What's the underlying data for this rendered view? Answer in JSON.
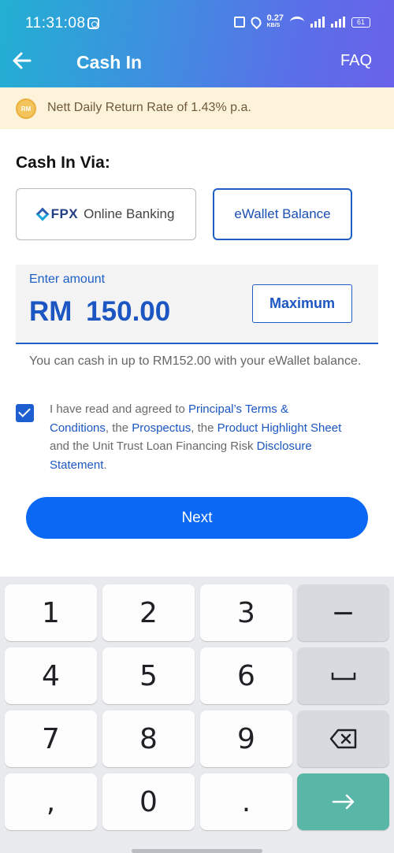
{
  "status_bar": {
    "time": "11:31:08",
    "network_speed": "0.27",
    "network_unit": "KB/S",
    "battery": "61"
  },
  "header": {
    "title": "Cash In",
    "faq_label": "FAQ"
  },
  "banner": {
    "icon_text": "RM",
    "text": "Nett Daily Return Rate of 1.43% p.a."
  },
  "cash_in": {
    "title": "Cash In Via:",
    "options": [
      {
        "logo_text": "FPX",
        "label": "Online Banking",
        "selected": false
      },
      {
        "label": "eWallet Balance",
        "selected": true
      }
    ]
  },
  "amount": {
    "label": "Enter amount",
    "currency": "RM",
    "value": "150.00",
    "maximum_label": "Maximum"
  },
  "limit_text": "You can cash in up to RM152.00 with your eWallet balance.",
  "terms": {
    "checked": true,
    "t1": "I have read and agreed to ",
    "link1": "Principal’s Terms & Conditions",
    "t2": ", the ",
    "link2": "Prospectus",
    "t3": ", the ",
    "link3": "Product Highlight Sheet",
    "t4": " and the Unit Trust Loan Financing Risk ",
    "link4": "Disclosure Statement",
    "t5": "."
  },
  "next_label": "Next",
  "keyboard": {
    "keys": [
      "1",
      "2",
      "3",
      "−",
      "4",
      "5",
      "6",
      "␣",
      "7",
      "8",
      "9",
      "⌫",
      ",",
      "0",
      ".",
      "→"
    ]
  },
  "colors": {
    "primary": "#0a68f4",
    "link": "#1b56c2",
    "banner_bg": "#fdf2da",
    "enter_key": "#5ab7a7"
  }
}
